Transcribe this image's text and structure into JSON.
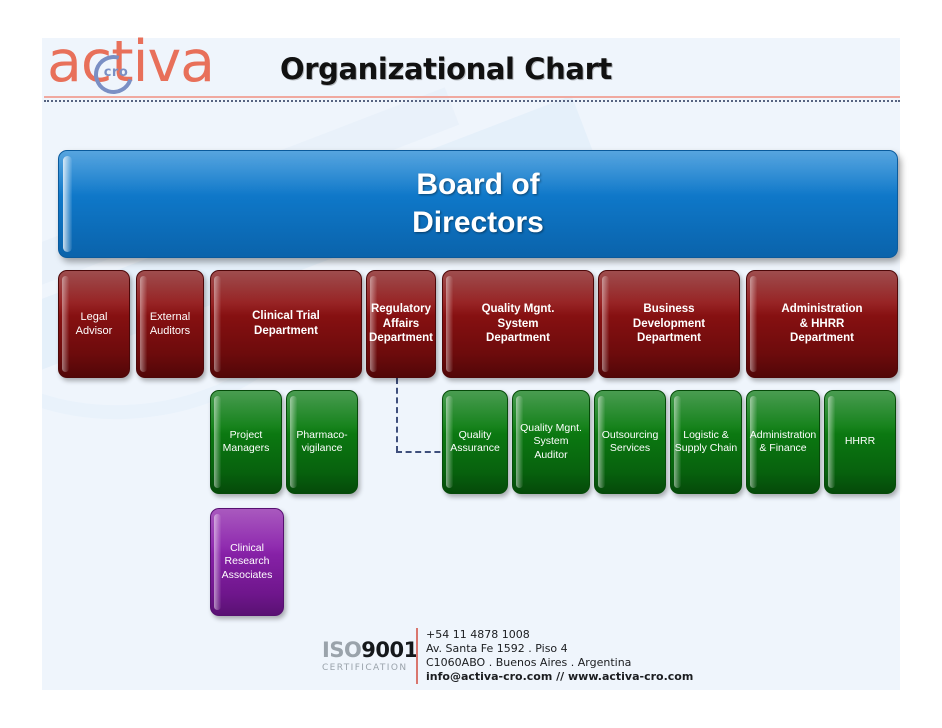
{
  "header": {
    "logo_text": "activa",
    "logo_inner": "cro",
    "title": "Organizational Chart"
  },
  "chart": {
    "root": {
      "label": "Board of\nDirectors",
      "color": "#0f78c9",
      "level": "root"
    },
    "departments": [
      {
        "label": "Legal\nAdvisor",
        "color": "#8f1213",
        "style": "plain"
      },
      {
        "label": "External\nAuditors",
        "color": "#8f1213",
        "style": "plain"
      },
      {
        "label": "Clinical Trial\nDepartment",
        "color": "#8f1213",
        "style": "bold"
      },
      {
        "label": "Regulatory\nAffairs\nDepartment",
        "color": "#8f1213",
        "style": "bold"
      },
      {
        "label": "Quality Mgnt.\nSystem\nDepartment",
        "color": "#8f1213",
        "style": "bold"
      },
      {
        "label": "Business\nDevelopment\nDepartment",
        "color": "#8f1213",
        "style": "bold"
      },
      {
        "label": "Administration\n& HHRR\nDepartment",
        "color": "#8f1213",
        "style": "bold"
      }
    ],
    "units": [
      {
        "label": "Project\nManagers",
        "color": "#0c7d12"
      },
      {
        "label": "Pharmaco-\nvigilance",
        "color": "#0c7d12"
      },
      {
        "label": "Quality\nAssurance",
        "color": "#0c7d12"
      },
      {
        "label": "Quality Mgnt.\nSystem\nAuditor",
        "color": "#0c7d12"
      },
      {
        "label": "Outsourcing\nServices",
        "color": "#0c7d12"
      },
      {
        "label": "Logistic &\nSupply Chain",
        "color": "#0c7d12"
      },
      {
        "label": "Administration\n& Finance",
        "color": "#0c7d12"
      },
      {
        "label": "HHRR",
        "color": "#0c7d12"
      }
    ],
    "sub_units": [
      {
        "label": "Clinical\nResearch\nAssociates",
        "color": "#8b23ac"
      }
    ]
  },
  "footer": {
    "iso_word": "ISO",
    "iso_number": "9001",
    "iso_certification": "CERTIFICATION",
    "phone": "+54 11 4878 1008",
    "address_line1": "Av. Santa Fe 1592 . Piso 4",
    "address_line2": "C1060ABO . Buenos Aires . Argentina",
    "web": "info@activa-cro.com // www.activa-cro.com"
  }
}
